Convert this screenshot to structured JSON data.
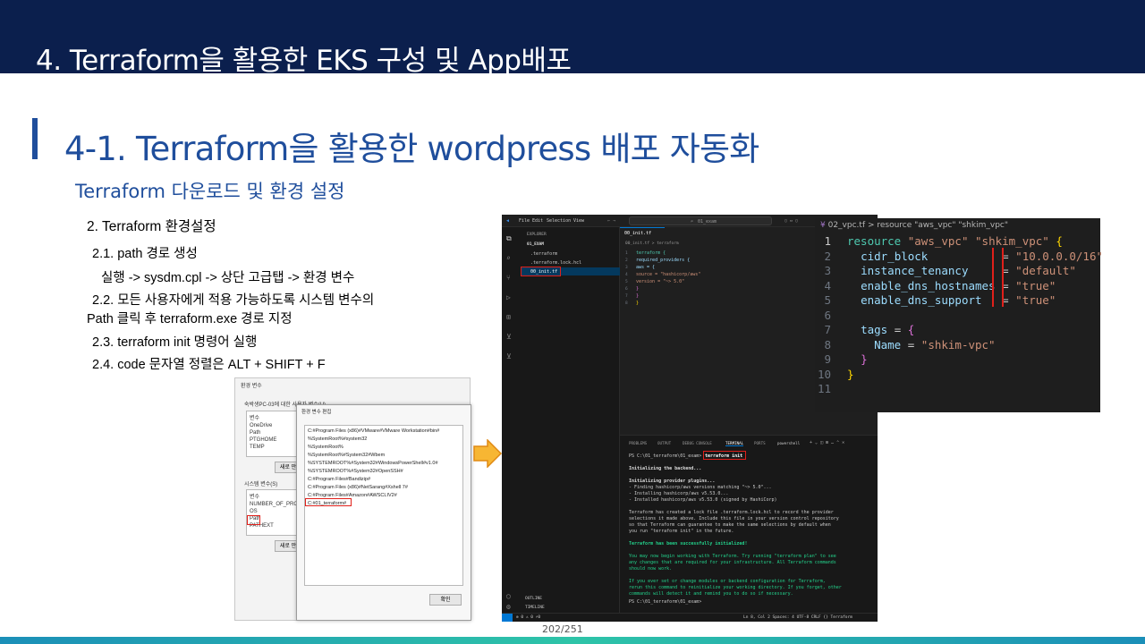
{
  "header": {
    "title": "4. Terraform을 활용한 EKS 구성 및 App배포"
  },
  "section": {
    "title": "4-1. Terraform을 활용한 wordpress 배포 자동화",
    "subtitle": "Terraform 다운로드 및 환경 설정"
  },
  "steps": {
    "heading": "2. Terraform 환경설정",
    "s1": "2.1. path 경로 생성",
    "s1_detail": "실행 -> sysdm.cpl -> 상단 고급탭 -> 환경 변수",
    "s2_line1": "2.2. 모든 사용자에게 적용 가능하도록 시스템 변수의",
    "s2_line2": "Path 클릭 후 terraform.exe 경로 지정",
    "s3": "2.3. terraform init 명령어 실행",
    "s4": "2.4. code 문자열 정렬은 ALT + SHIFT + F"
  },
  "env_dialog": {
    "title": "환경 변수",
    "user_vars_label": "숙박생PC-03에 대한 사용자 변수(U)",
    "user_vars_header": "변수",
    "user_vars": [
      "OneDrive",
      "Path",
      "PTGHOME",
      "TEMP"
    ],
    "new_button": "새로 만",
    "system_vars_label": "시스템 변수(S)",
    "system_vars_header": "변수",
    "system_vars": [
      "NUMBER_OF_PRO...",
      "OS",
      "Path",
      "PATHEXT"
    ],
    "new_button2": "새로 만"
  },
  "edit_dialog": {
    "title": "환경 변수 편집",
    "paths": [
      "C:#Program Files (x86)#VMware#VMware Workstation#bin#",
      "%SystemRoot%#system32",
      "%SystemRoot%",
      "%SystemRoot%#System32#Wbem",
      "%SYSTEMROOT%#System32#WindowsPowerShell#v1.0#",
      "%SYSTEMROOT%#System32#OpenSSH#",
      "C:#Program Files#Bandizip#",
      "C:#Program Files (x86)#NetSarang#Xshell 7#",
      "C:#Program Files#Amazon#AWSCLIV2#",
      "C:#01_terraform#"
    ],
    "ok_button": "확인"
  },
  "vscode": {
    "menu": [
      "File",
      "Edit",
      "Selection",
      "View"
    ],
    "search": "01_exam",
    "explorer_label": "EXPLORER",
    "folder": "01_EXAM",
    "files": [
      ".terraform",
      ".terraform.lock.hcl",
      "00_init.tf"
    ],
    "tab": "00_init.tf",
    "breadcrumb": "00_init.tf > terraform",
    "editor_lines": [
      "terraform {",
      "  required_providers {",
      "    aws = {",
      "      source = \"hashicorp/aws\"",
      "      version = \"~> 5.0\"",
      "    }",
      "  }",
      "}"
    ],
    "panel_tabs": [
      "PROBLEMS",
      "OUTPUT",
      "DEBUG CONSOLE",
      "TERMINAL",
      "PORTS"
    ],
    "shell": "powershell",
    "prompt": "PS C:\\01_terraform\\01_exam>",
    "command": "terraform init",
    "terminal_lines": [
      "Initializing the backend...",
      "",
      "Initializing provider plugins...",
      "- Finding hashicorp/aws versions matching \"~> 5.0\"...",
      "- Installing hashicorp/aws v5.53.0...",
      "- Installed hashicorp/aws v5.53.0 (signed by HashiCorp)",
      "",
      "Terraform has created a lock file .terraform.lock.hcl to record the provider",
      "selections it made above. Include this file in your version control repository",
      "so that Terraform can guarantee to make the same selections by default when",
      "you run \"terraform init\" in the future.",
      "",
      "Terraform has been successfully initialized!",
      "",
      "You may now begin working with Terraform. Try running \"terraform plan\" to see",
      "any changes that are required for your infrastructure. All Terraform commands",
      "should now work.",
      "",
      "If you ever set or change modules or backend configuration for Terraform,",
      "rerun this command to reinitialize your working directory. If you forget, other",
      "commands will detect it and remind you to do so if necessary."
    ],
    "outline": "OUTLINE",
    "timeline": "TIMELINE",
    "status_left": "⊗ 0 ⚠ 0   ⚡0",
    "status_right": "Ln 8, Col 2   Spaces: 4   UTF-8   CRLF   {} Terraform"
  },
  "code_panel": {
    "breadcrumb": "02_vpc.tf > resource \"aws_vpc\" \"shkim_vpc\"",
    "lines": [
      {
        "n": "1",
        "parts": [
          [
            "kw",
            "resource"
          ],
          [
            "",
            " "
          ],
          [
            "st",
            "\"aws_vpc\""
          ],
          [
            "",
            " "
          ],
          [
            "st",
            "\"shkim_vpc\""
          ],
          [
            "",
            " "
          ],
          [
            "br1",
            "{"
          ]
        ]
      },
      {
        "n": "2",
        "parts": [
          [
            "",
            "  "
          ],
          [
            "pr",
            "cidr_block"
          ],
          [
            "",
            "           = "
          ],
          [
            "st",
            "\"10.0.0.0/16\""
          ]
        ]
      },
      {
        "n": "3",
        "parts": [
          [
            "",
            "  "
          ],
          [
            "pr",
            "instance_tenancy"
          ],
          [
            "",
            "     = "
          ],
          [
            "st",
            "\"default\""
          ]
        ]
      },
      {
        "n": "4",
        "parts": [
          [
            "",
            "  "
          ],
          [
            "pr",
            "enable_dns_hostnames"
          ],
          [
            "",
            " = "
          ],
          [
            "st",
            "\"true\""
          ]
        ]
      },
      {
        "n": "5",
        "parts": [
          [
            "",
            "  "
          ],
          [
            "pr",
            "enable_dns_support"
          ],
          [
            "",
            "   = "
          ],
          [
            "st",
            "\"true\""
          ]
        ]
      },
      {
        "n": "6",
        "parts": []
      },
      {
        "n": "7",
        "parts": [
          [
            "",
            "  "
          ],
          [
            "pr",
            "tags"
          ],
          [
            "",
            " = "
          ],
          [
            "br2",
            "{"
          ]
        ]
      },
      {
        "n": "8",
        "parts": [
          [
            "",
            "    "
          ],
          [
            "pr",
            "Name"
          ],
          [
            "",
            " = "
          ],
          [
            "st",
            "\"shkim-vpc\""
          ]
        ]
      },
      {
        "n": "9",
        "parts": [
          [
            "",
            "  "
          ],
          [
            "br2",
            "}"
          ]
        ]
      },
      {
        "n": "10",
        "parts": [
          [
            "br1",
            "}"
          ]
        ]
      },
      {
        "n": "11",
        "parts": []
      }
    ]
  },
  "footer": {
    "page": "202/251"
  }
}
